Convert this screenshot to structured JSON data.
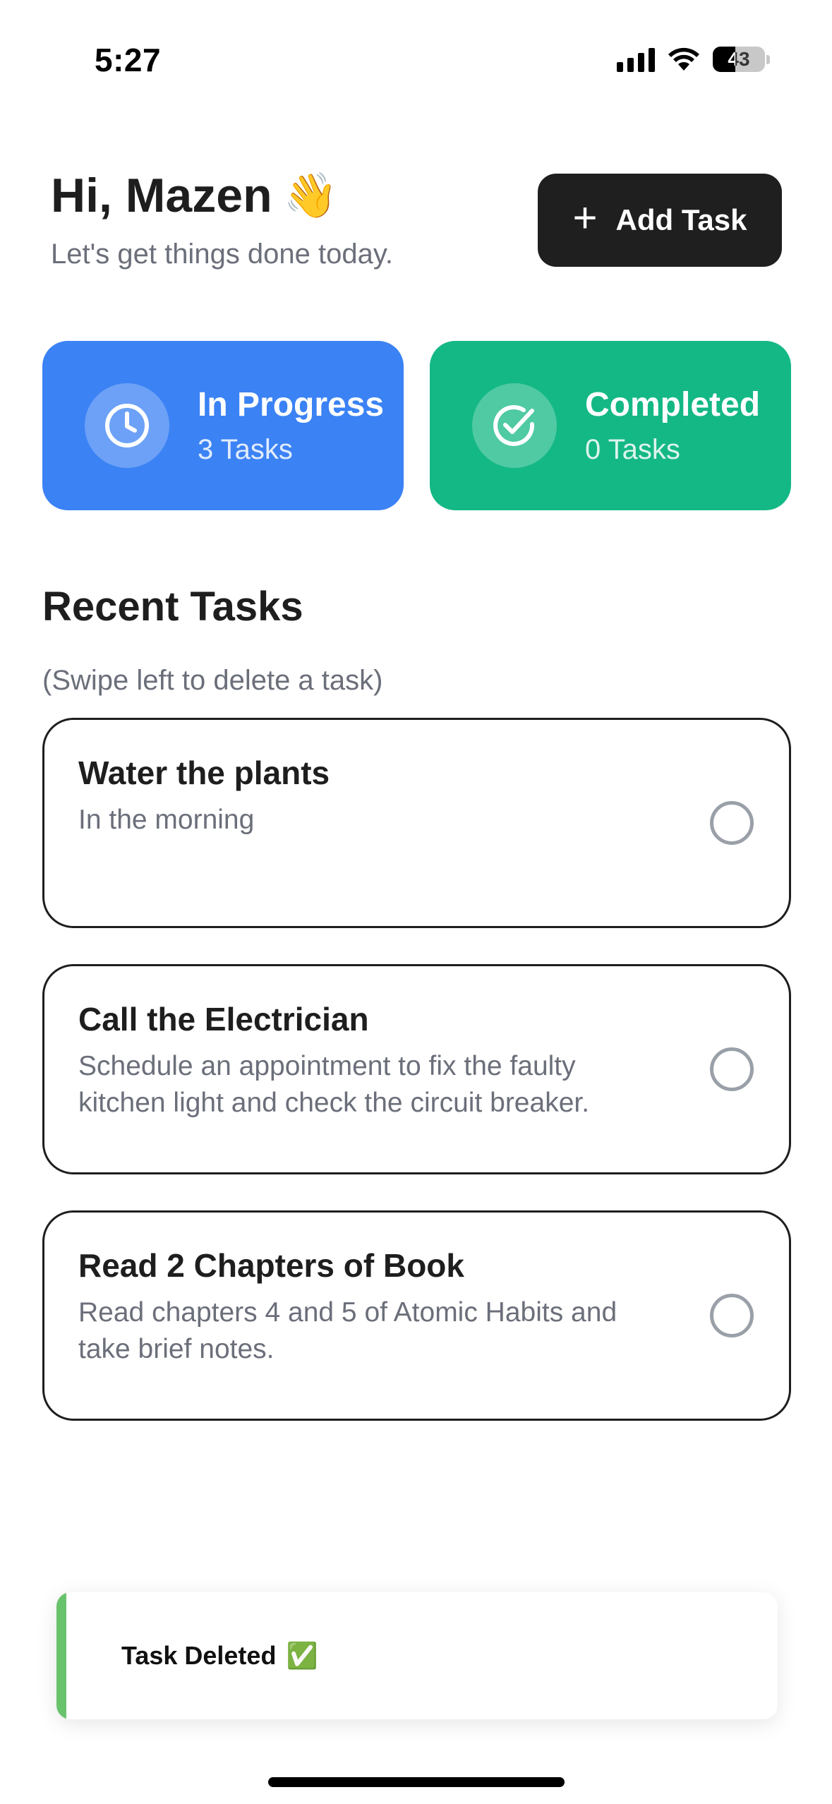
{
  "status_bar": {
    "time": "5:27",
    "battery_level": "43",
    "battery_fraction": 0.43
  },
  "header": {
    "greeting": "Hi, Mazen",
    "greeting_emoji": "👋",
    "subtitle": "Let's get things done today.",
    "add_task_label": "Add Task",
    "add_task_icon": "plus-icon"
  },
  "stats": [
    {
      "title": "In Progress",
      "count": "3 Tasks",
      "icon": "clock-icon",
      "color": "#3b82f4"
    },
    {
      "title": "Completed",
      "count": "0 Tasks",
      "icon": "check-circle-icon",
      "color": "#14b885"
    }
  ],
  "recent": {
    "title": "Recent Tasks",
    "hint": "(Swipe left to delete a task)",
    "tasks": [
      {
        "title": "Water the plants",
        "description": "In the morning",
        "completed": false
      },
      {
        "title": "Call the Electrician",
        "description": "Schedule an appointment to fix the faulty kitchen light and check the circuit breaker.",
        "completed": false
      },
      {
        "title": "Read 2 Chapters of Book",
        "description": "Read chapters 4 and 5 of Atomic Habits and take brief notes.",
        "completed": false
      }
    ]
  },
  "toast": {
    "message": "Task Deleted",
    "emoji": "✅",
    "accent_color": "#69c36d"
  }
}
